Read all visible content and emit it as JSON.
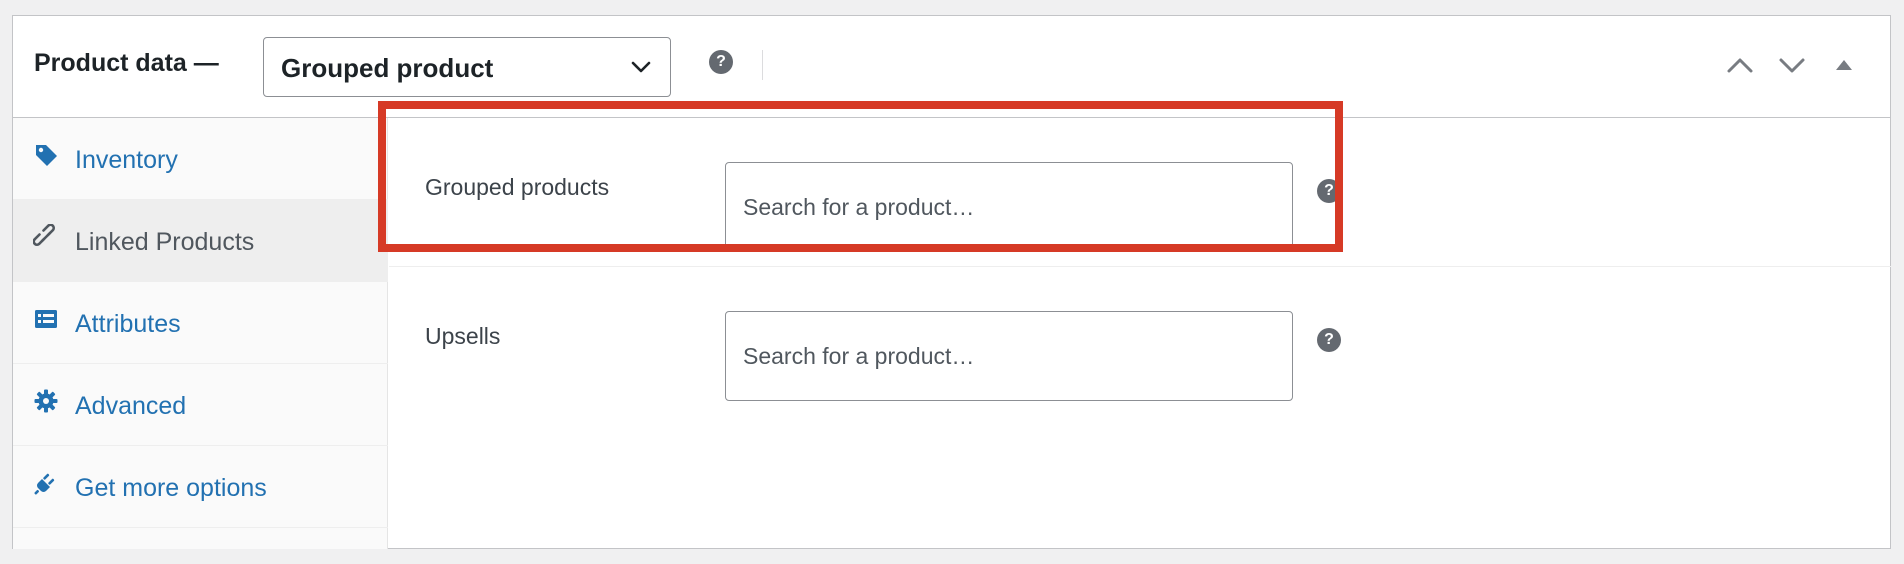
{
  "header": {
    "title": "Product data —",
    "product_type": "Grouped product"
  },
  "sidebar": {
    "items": [
      {
        "label": "Inventory",
        "icon": "tag-icon"
      },
      {
        "label": "Linked Products",
        "icon": "link-icon",
        "active": true
      },
      {
        "label": "Attributes",
        "icon": "list-icon"
      },
      {
        "label": "Advanced",
        "icon": "gear-icon"
      },
      {
        "label": "Get more options",
        "icon": "plug-icon"
      }
    ]
  },
  "main": {
    "fields": [
      {
        "label": "Grouped products",
        "placeholder": "Search for a product…"
      },
      {
        "label": "Upsells",
        "placeholder": "Search for a product…"
      }
    ]
  },
  "colors": {
    "link": "#2271b1",
    "highlight": "#d63a26",
    "active_tab_bg": "#eeeeee"
  }
}
